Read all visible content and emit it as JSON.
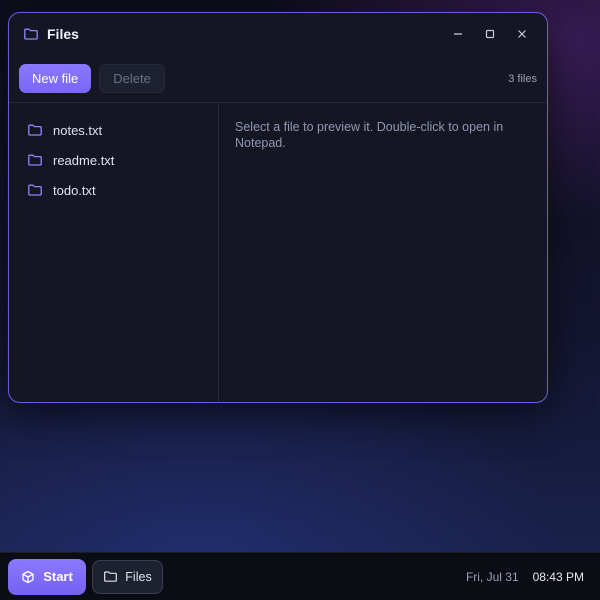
{
  "window": {
    "title": "Files",
    "controls": {
      "minimize": "minimize-icon",
      "maximize": "maximize-icon",
      "close": "close-icon"
    }
  },
  "toolbar": {
    "new_file_label": "New file",
    "delete_label": "Delete",
    "count": "3 files"
  },
  "files": [
    {
      "name": "notes.txt",
      "icon": "folder-icon"
    },
    {
      "name": "readme.txt",
      "icon": "folder-icon"
    },
    {
      "name": "todo.txt",
      "icon": "folder-icon"
    }
  ],
  "preview": {
    "text": "Select a file to preview it. Double-click to open in Notepad."
  },
  "taskbar": {
    "start_label": "Start",
    "apps": [
      {
        "label": "Files",
        "icon": "folder-icon"
      }
    ],
    "date": "Fri, Jul 31",
    "time": "08:43 PM"
  },
  "colors": {
    "accent": "#7a66f5",
    "window_bg": "#141624",
    "border": "#6c5bd6"
  }
}
